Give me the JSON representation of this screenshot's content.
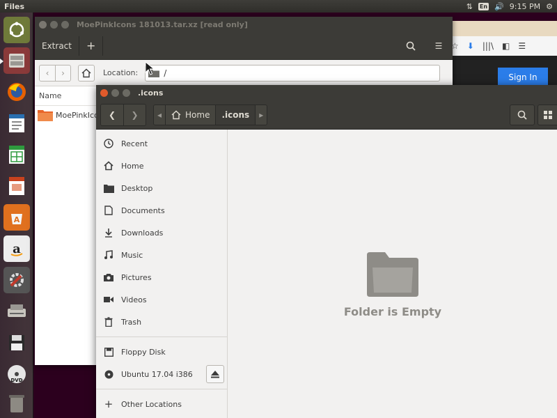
{
  "top_panel": {
    "app_name": "Files",
    "keyboard": "En",
    "clock": "9:15 PM"
  },
  "launcher": {
    "items": [
      {
        "name": "ubuntu-dash-icon"
      },
      {
        "name": "file-cabinet-icon"
      },
      {
        "name": "firefox-icon"
      },
      {
        "name": "writer-icon"
      },
      {
        "name": "calc-icon"
      },
      {
        "name": "impress-icon"
      },
      {
        "name": "software-center-icon"
      },
      {
        "name": "amazon-icon"
      },
      {
        "name": "system-settings-icon"
      },
      {
        "name": "scanner-icon"
      },
      {
        "name": "floppy-disk-icon"
      },
      {
        "name": "dvd-icon"
      },
      {
        "name": "trash-icon"
      }
    ]
  },
  "browser": {
    "sign_in": "Sign In"
  },
  "archive": {
    "title": "MoePinkIcons 181013.tar.xz [read only]",
    "extract_label": "Extract",
    "location_label": "Location:",
    "location_value": "/",
    "column_name": "Name",
    "rows": [
      {
        "name": "MoePinkIcons"
      }
    ]
  },
  "files": {
    "title": ".icons",
    "breadcrumb": [
      "Home",
      ".icons"
    ],
    "sidebar": {
      "places": [
        "Recent",
        "Home",
        "Desktop",
        "Documents",
        "Downloads",
        "Music",
        "Pictures",
        "Videos",
        "Trash"
      ],
      "devices": [
        "Floppy Disk",
        "Ubuntu 17.04 i386"
      ],
      "other": "Other Locations"
    },
    "empty_text": "Folder is Empty"
  }
}
